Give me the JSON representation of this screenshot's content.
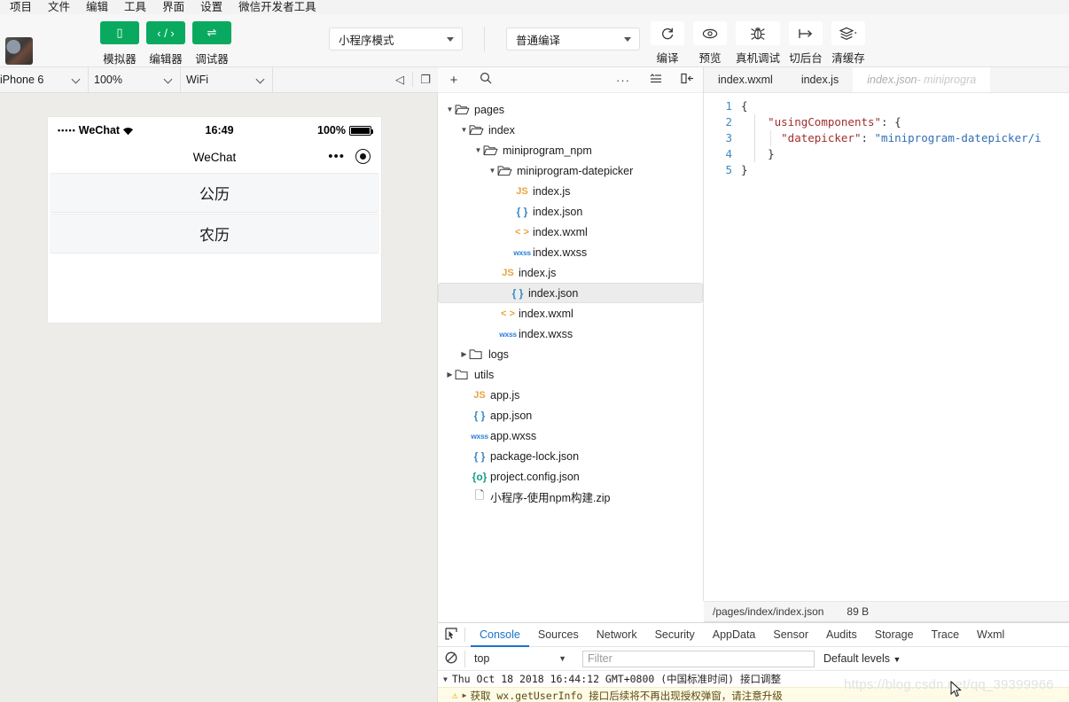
{
  "menubar": {
    "items": [
      "项目",
      "文件",
      "编辑",
      "工具",
      "界面",
      "设置",
      "微信开发者工具"
    ]
  },
  "toolbar": {
    "mode_buttons": [
      {
        "label": "模拟器",
        "icon": "phone-icon",
        "glyph": "▯"
      },
      {
        "label": "编辑器",
        "icon": "code-icon",
        "glyph": "‹ / ›"
      },
      {
        "label": "调试器",
        "icon": "debug-icon",
        "glyph": "⇌"
      }
    ],
    "accent_color": "#09aa5f",
    "mode_select": "小程序模式",
    "compile_select": "普通编译",
    "action_buttons": [
      {
        "label": "编译",
        "icon": "refresh-icon",
        "glyph": "⟳"
      },
      {
        "label": "预览",
        "icon": "eye-icon",
        "glyph": "👁"
      },
      {
        "label": "真机调试",
        "icon": "bug-icon",
        "glyph": "🐞"
      },
      {
        "label": "切后台",
        "icon": "background-icon",
        "glyph": "↦"
      },
      {
        "label": "清缓存",
        "icon": "layers-icon",
        "glyph": "≋"
      }
    ]
  },
  "simulator": {
    "device": "iPhone 6",
    "zoom": "100%",
    "network": "WiFi",
    "icons": [
      "volume-icon",
      "rotate-icon"
    ],
    "phone": {
      "carrier": "WeChat",
      "signal_dots": "•••••",
      "wifi_icon": "wifi-icon",
      "time": "16:49",
      "battery_percent": "100%",
      "nav_title": "WeChat",
      "capsule_more": "•••",
      "capsule_target": "target-icon",
      "cells": [
        "公历",
        "农历"
      ]
    }
  },
  "explorer": {
    "toolbar_icons": [
      "add-icon",
      "search-icon",
      "more-icon",
      "collapse-icon",
      "hide-sidebar-icon"
    ],
    "tree": [
      {
        "depth": 0,
        "type": "folder",
        "name": "pages",
        "expanded": true
      },
      {
        "depth": 1,
        "type": "folder",
        "name": "index",
        "expanded": true
      },
      {
        "depth": 2,
        "type": "folder",
        "name": "miniprogram_npm",
        "expanded": true
      },
      {
        "depth": 3,
        "type": "folder",
        "name": "miniprogram-datepicker",
        "expanded": true
      },
      {
        "depth": 4,
        "type": "js",
        "name": "index.js"
      },
      {
        "depth": 4,
        "type": "json",
        "name": "index.json"
      },
      {
        "depth": 4,
        "type": "wxml",
        "name": "index.wxml"
      },
      {
        "depth": 4,
        "type": "wxss",
        "name": "index.wxss"
      },
      {
        "depth": 3,
        "type": "js",
        "name": "index.js"
      },
      {
        "depth": 3,
        "type": "json",
        "name": "index.json",
        "selected": true
      },
      {
        "depth": 3,
        "type": "wxml",
        "name": "index.wxml"
      },
      {
        "depth": 3,
        "type": "wxss",
        "name": "index.wxss"
      },
      {
        "depth": 1,
        "type": "folder",
        "name": "logs",
        "expanded": false
      },
      {
        "depth": 0,
        "type": "folder",
        "name": "utils",
        "expanded": false
      },
      {
        "depth": 1,
        "type": "js",
        "name": "app.js"
      },
      {
        "depth": 1,
        "type": "json",
        "name": "app.json"
      },
      {
        "depth": 1,
        "type": "wxss",
        "name": "app.wxss"
      },
      {
        "depth": 1,
        "type": "json",
        "name": "package-lock.json"
      },
      {
        "depth": 1,
        "type": "cfg",
        "name": "project.config.json"
      },
      {
        "depth": 1,
        "type": "file",
        "name": "小程序-使用npm构建.zip"
      }
    ]
  },
  "editor": {
    "tabs": [
      {
        "label": "index.wxml",
        "active": false,
        "dim": false
      },
      {
        "label": "index.js",
        "active": false,
        "dim": false
      },
      {
        "label": "index.json",
        "sub": " - miniprogra",
        "active": true,
        "dim": true
      }
    ],
    "lines": [
      {
        "n": "1",
        "text": "{"
      },
      {
        "n": "2",
        "text": "    \"usingComponents\": {"
      },
      {
        "n": "3",
        "text": "      \"datepicker\": \"miniprogram-datepicker/i"
      },
      {
        "n": "4",
        "text": "    }"
      },
      {
        "n": "5",
        "text": "}"
      }
    ],
    "status_path": "/pages/index/index.json",
    "status_size": "89 B"
  },
  "devtools": {
    "tabs": [
      "Console",
      "Sources",
      "Network",
      "Security",
      "AppData",
      "Sensor",
      "Audits",
      "Storage",
      "Trace",
      "Wxml"
    ],
    "active_tab": "Console",
    "cursor_icon": "inspect-icon",
    "clear_icon": "clear-console-icon",
    "context": "top",
    "filter_placeholder": "Filter",
    "levels": "Default levels",
    "logs": [
      {
        "kind": "info",
        "text": "Thu Oct 18 2018 16:44:12 GMT+0800 (中国标准时间) 接口调整"
      },
      {
        "kind": "warn",
        "text": "获取 wx.getUserInfo 接口后续将不再出现授权弹窗，请注意升级"
      }
    ]
  },
  "watermark": "https://blog.csdn.net/qq_39399966"
}
